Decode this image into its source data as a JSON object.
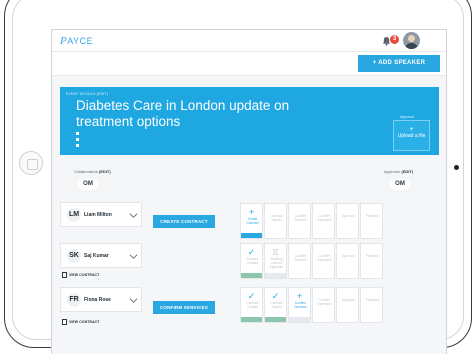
{
  "header": {
    "logo_initial": "P",
    "logo_rest": "AYCE",
    "notification_count": "3",
    "add_speaker_label": "+ ADD SPEAKER"
  },
  "event": {
    "details_label": "EVENT DETAILS (EDIT)",
    "title": "Diabetes Care in London update on treatment options",
    "meta_1": "",
    "meta_2": "",
    "meta_3": "",
    "approval_label": "Approval",
    "upload_plus": "+",
    "upload_label": "Upload a file"
  },
  "collaborators": {
    "label_prefix": "Collaborators",
    "label_edit": "(EDIT)",
    "badge": "OM"
  },
  "approver": {
    "label_prefix": "Approver",
    "label_edit": "(EDIT)",
    "badge": "OM"
  },
  "view_contract_label": "VIEW CONTRACT",
  "steps": {
    "create_contract": "Create Contract",
    "contract_created": "Contract Created",
    "contract_signed": "Contract Signed",
    "awaiting_contract_signature": "Awaiting Contract Signature",
    "confirm_services": "Confirm Services",
    "confirm_expenses": "Confirm Expenses",
    "approval": "Approval",
    "payment": "Payment"
  },
  "speakers": [
    {
      "initials": "LM",
      "name": "Liam Milton",
      "action_label": "CREATE CONTRACT"
    },
    {
      "initials": "SK",
      "name": "Saj Kumar"
    },
    {
      "initials": "FR",
      "name": "Fiona Rose",
      "action_label": "CONFIRM SERVICES"
    }
  ],
  "colors": {
    "accent": "#29a7e1",
    "hero": "#1ea7e1",
    "done_bar": "#8cc7ad",
    "badge": "#e64b3c"
  }
}
